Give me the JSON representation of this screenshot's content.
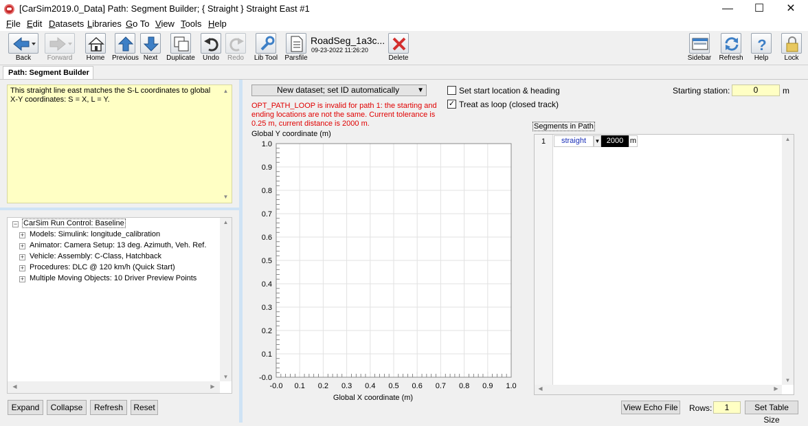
{
  "window": {
    "title": "[CarSim2019.0_Data] Path: Segment Builder; { Straight } Straight East #1",
    "minimize": "—",
    "maximize": "☐",
    "close": "✕"
  },
  "menu": [
    {
      "label": "File"
    },
    {
      "label": "Edit"
    },
    {
      "label": "Datasets"
    },
    {
      "label": "Libraries"
    },
    {
      "label": "Go To"
    },
    {
      "label": "View"
    },
    {
      "label": "Tools"
    },
    {
      "label": "Help"
    }
  ],
  "toolbar": {
    "back": "Back",
    "forward": "Forward",
    "home": "Home",
    "previous": "Previous",
    "next": "Next",
    "duplicate": "Duplicate",
    "undo": "Undo",
    "redo": "Redo",
    "lib_tool": "Lib Tool",
    "parsfile": "Parsfile",
    "parsfile_title": "RoadSeg_1a3c...",
    "parsfile_date": "09-23-2022 11:26:20",
    "delete": "Delete",
    "sidebar": "Sidebar",
    "refresh": "Refresh",
    "help": "Help",
    "lock": "Lock"
  },
  "tab": {
    "label": "Path: Segment Builder"
  },
  "notes": {
    "text": "This straight line east matches the S-L coordinates to global X-Y coordinates: S = X, L = Y."
  },
  "tree": {
    "root": "CarSim Run Control: Baseline",
    "items": [
      "Models: Simulink: longitude_calibration",
      "Animator: Camera Setup: 13 deg. Azimuth, Veh. Ref.",
      "Vehicle: Assembly: C-Class, Hatchback",
      "Procedures: DLC @ 120 km/h (Quick Start)",
      "Multiple Moving Objects: 10 Driver Preview Points"
    ]
  },
  "left_buttons": {
    "expand": "Expand",
    "collapse": "Collapse",
    "refresh": "Refresh",
    "reset": "Reset"
  },
  "dataset_select": {
    "value": "New dataset; set ID automatically"
  },
  "options": {
    "set_start": {
      "label": "Set start location & heading",
      "checked": false
    },
    "treat_loop": {
      "label": "Treat as loop (closed track)",
      "checked": true
    }
  },
  "error": {
    "text": "OPT_PATH_LOOP is invalid for path 1: the starting and ending locations are not the same. Current tolerance is 0.25 m, current distance is 2000 m.",
    "color": "#e00000"
  },
  "starting_station": {
    "label": "Starting station:",
    "value": "0",
    "unit": "m"
  },
  "segments": {
    "label": "Segments in Path",
    "rows": [
      {
        "index": "1",
        "type": "straight",
        "length": "2000",
        "unit": "m"
      }
    ]
  },
  "bottom": {
    "view_echo": "View Echo File",
    "rows_label": "Rows:",
    "rows_value": "1",
    "set_table_size": "Set Table Size"
  },
  "chart_data": {
    "type": "line",
    "title": "",
    "ylabel": "Global Y coordinate (m)",
    "xlabel": "Global X coordinate (m)",
    "xlim": [
      0.0,
      1.0
    ],
    "ylim": [
      0.0,
      1.0
    ],
    "xticks": [
      "-0.0",
      "0.1",
      "0.2",
      "0.3",
      "0.4",
      "0.5",
      "0.6",
      "0.7",
      "0.8",
      "0.9",
      "1.0"
    ],
    "yticks": [
      "-0.0",
      "0.1",
      "0.2",
      "0.3",
      "0.4",
      "0.5",
      "0.6",
      "0.7",
      "0.8",
      "0.9",
      "1.0"
    ],
    "grid": true,
    "series": []
  }
}
